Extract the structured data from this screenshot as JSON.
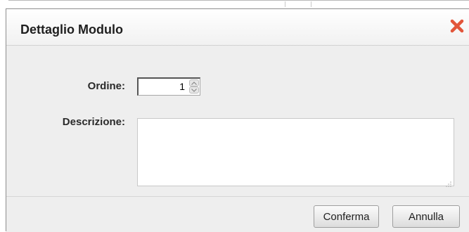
{
  "dialog": {
    "title": "Dettaglio Modulo",
    "close_icon": "close-x-icon",
    "close_color": "#e2553a"
  },
  "form": {
    "ordine": {
      "label": "Ordine:",
      "value": "1"
    },
    "descrizione": {
      "label": "Descrizione:",
      "value": ""
    }
  },
  "footer": {
    "confirm_label": "Conferma",
    "cancel_label": "Annulla"
  }
}
